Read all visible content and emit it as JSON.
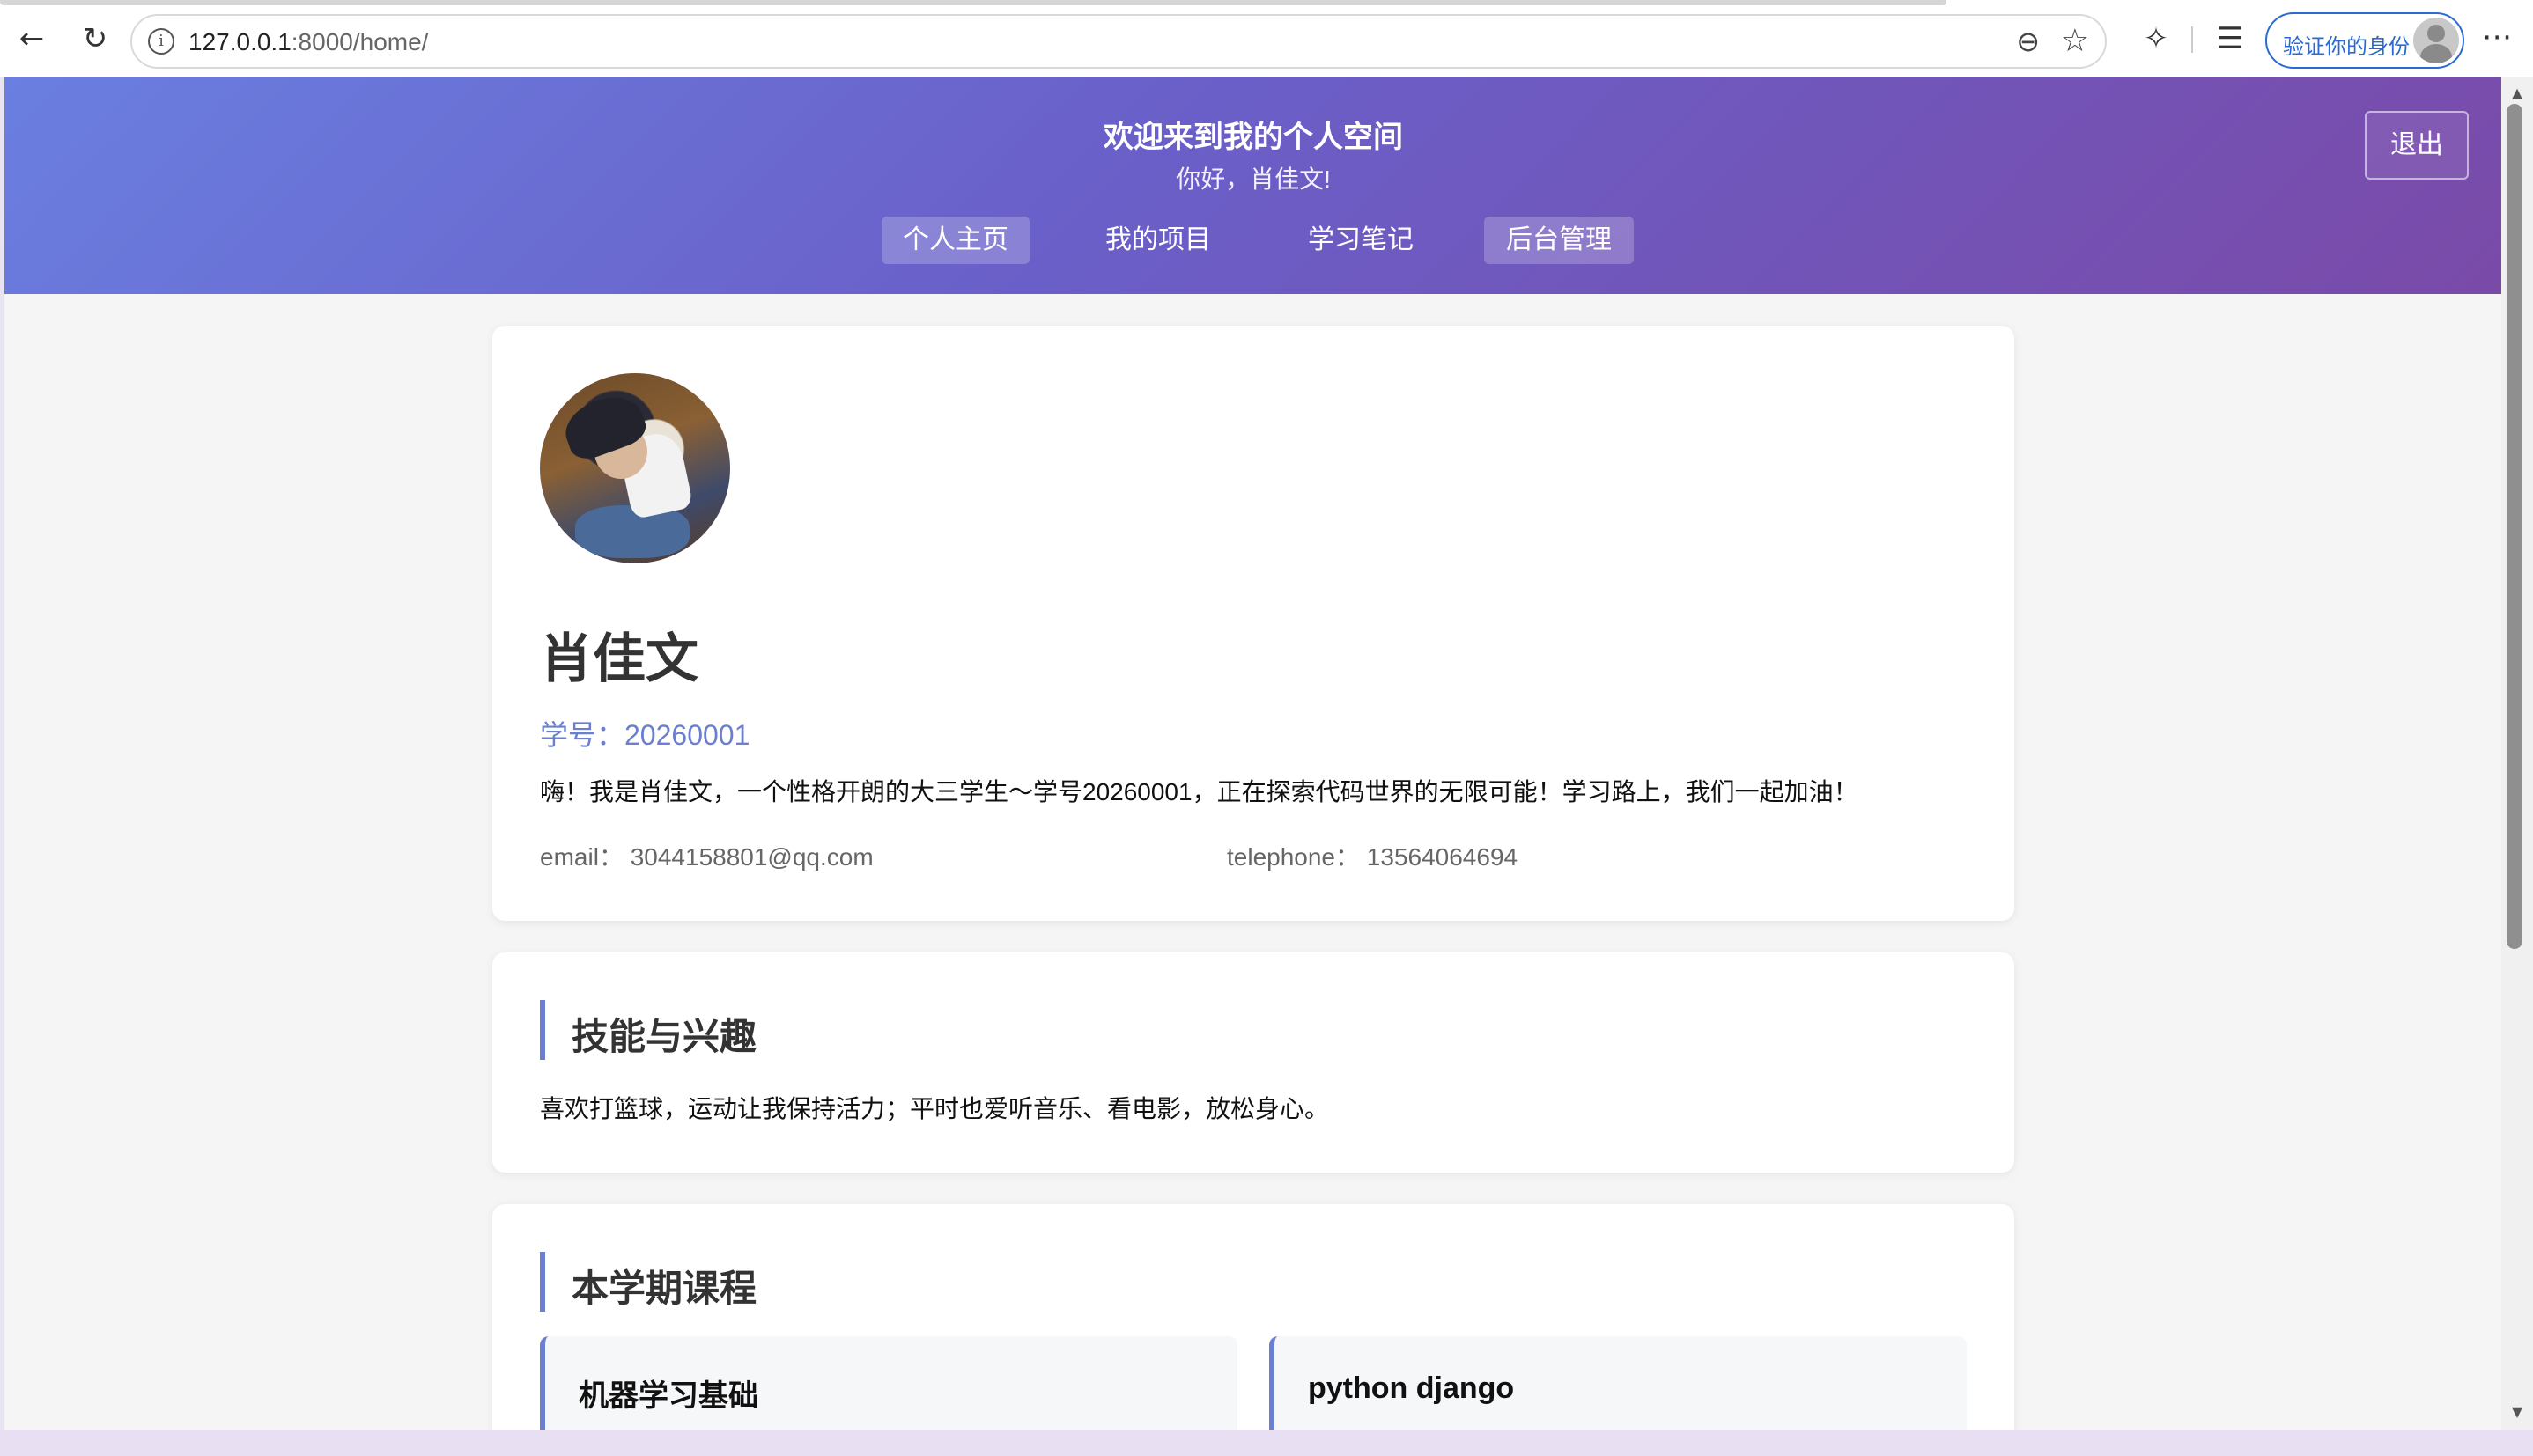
{
  "browser": {
    "url_host": "127.0.0.1",
    "url_rest": ":8000/home/",
    "verify_label": "验证你的身份",
    "icons": [
      "back-arrow-icon",
      "reload-icon",
      "info-icon",
      "zoom-out-icon",
      "star-icon",
      "extensions-icon",
      "favorites-icon",
      "more-icon"
    ]
  },
  "header": {
    "title": "欢迎来到我的个人空间",
    "greeting": "你好，肖佳文!",
    "nav": [
      {
        "label": "个人主页",
        "active": true
      },
      {
        "label": "我的项目",
        "active": false
      },
      {
        "label": "学习笔记",
        "active": false
      },
      {
        "label": "后台管理",
        "active": true
      }
    ],
    "logout_label": "退出"
  },
  "profile": {
    "name": "肖佳文",
    "student_id": "学号：20260001",
    "bio": "嗨！我是肖佳文，一个性格开朗的大三学生～学号20260001，正在探索代码世界的无限可能！学习路上，我们一起加油！",
    "email_label": "email：",
    "email": "3044158801@qq.com",
    "phone_label": "telephone：",
    "phone": "13564064694"
  },
  "skills": {
    "title": "技能与兴趣",
    "text": "喜欢打篮球，运动让我保持活力；平时也爱听音乐、看电影，放松身心。"
  },
  "courses": {
    "title": "本学期课程",
    "items": [
      "机器学习基础",
      "python django"
    ]
  },
  "colors": {
    "header_gradient_start": "#6a7fe0",
    "header_gradient_end": "#7a4aa8",
    "accent": "#6b7fd0"
  }
}
